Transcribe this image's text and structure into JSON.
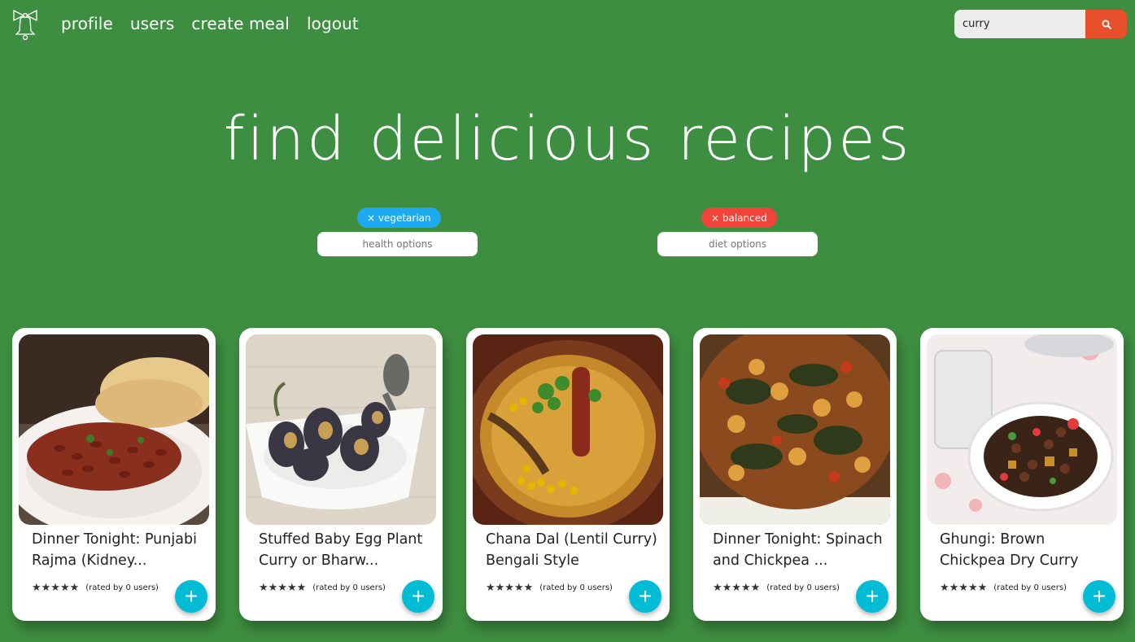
{
  "nav": {
    "links": [
      "profile",
      "users",
      "create meal",
      "logout"
    ]
  },
  "search": {
    "value": "curry"
  },
  "hero": {
    "title": "find delicious recipes"
  },
  "filters": {
    "health": {
      "chip": "× vegetarian",
      "placeholder": "health options"
    },
    "diet": {
      "chip": "× balanced",
      "placeholder": "diet options"
    }
  },
  "cards": [
    {
      "title": "Dinner Tonight: Punjabi Rajma (Kidney...",
      "stars": "★★★★★",
      "rated": "(rated by 0 users)",
      "add": "+"
    },
    {
      "title": "Stuffed Baby Egg Plant Curry or Bharw...",
      "stars": "★★★★★",
      "rated": "(rated by 0 users)",
      "add": "+"
    },
    {
      "title": "Chana Dal (Lentil Curry) Bengali Style",
      "stars": "★★★★★",
      "rated": "(rated by 0 users)",
      "add": "+"
    },
    {
      "title": "Dinner Tonight: Spinach and Chickpea ...",
      "stars": "★★★★★",
      "rated": "(rated by 0 users)",
      "add": "+"
    },
    {
      "title": "Ghungi: Brown Chickpea Dry Curry",
      "stars": "★★★★★",
      "rated": "(rated by 0 users)",
      "add": "+"
    }
  ],
  "colors": {
    "background": "#3e8e41",
    "search_button": "#e84f2c",
    "chip_health": "#1eaaf1",
    "chip_diet": "#f0433a",
    "add_button": "#00bcd4"
  }
}
